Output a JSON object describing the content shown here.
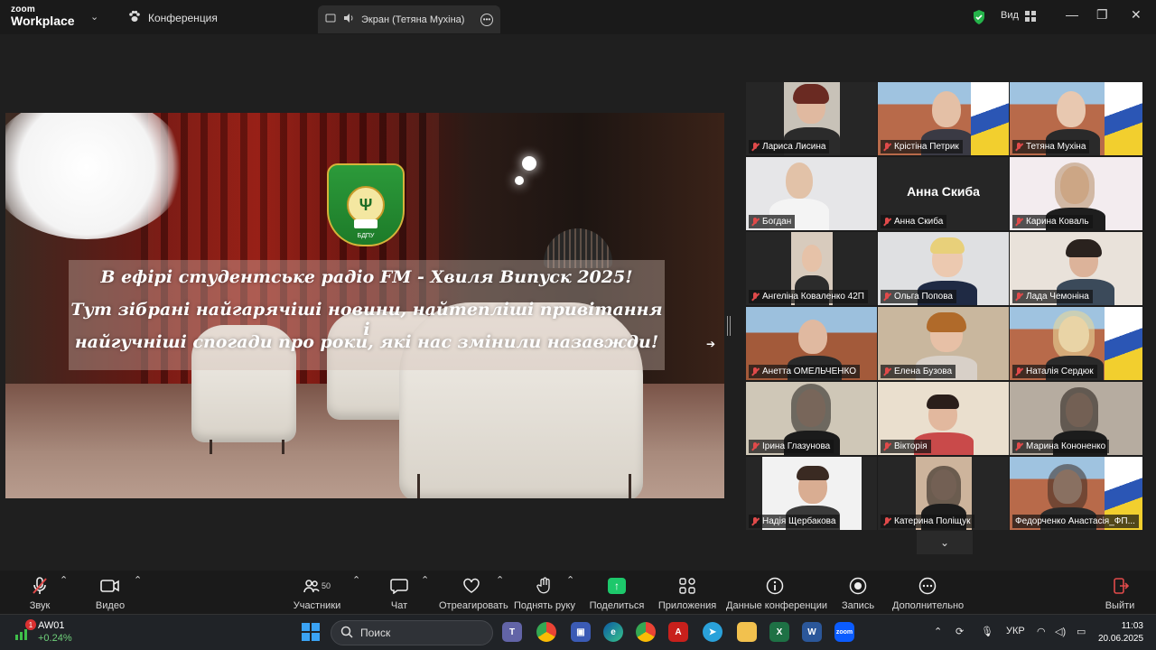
{
  "titlebar": {
    "brand_small": "zoom",
    "brand_name": "Workplace",
    "meeting_label": "Конференция",
    "screen_tab": "Экран (Тетяна Мухіна)",
    "view_label": "Вид"
  },
  "share": {
    "crest_text": "БДПУ",
    "crest_symbol": "Ψ",
    "line1": "В ефірі студентське радіо FM - Хвиля Випуск 2025!",
    "line2": "Тут зібрані найгарячіші новини, найтепліші привітання і",
    "line3": "найгучніші спогади про роки, які нас змінили назавжди!"
  },
  "gallery": {
    "participants": [
      {
        "name": "Лариса Лисина"
      },
      {
        "name": "Крістіна Петрик"
      },
      {
        "name": "Тетяна Мухіна"
      },
      {
        "name": "Богдан"
      },
      {
        "name": "Анна Скиба",
        "display": "Анна Скиба"
      },
      {
        "name": "Карина Коваль"
      },
      {
        "name": "Ангеліна Коваленко 42П"
      },
      {
        "name": "Ольга Попова"
      },
      {
        "name": "Лада Чемоніна"
      },
      {
        "name": "Анетта ОМЕЛЬЧЕНКО"
      },
      {
        "name": "Елена Бузова"
      },
      {
        "name": "Наталія Сердюк"
      },
      {
        "name": "Ірина Глазунова"
      },
      {
        "name": "Вікторія"
      },
      {
        "name": "Марина Кононенко"
      },
      {
        "name": "Надія Щербакова"
      },
      {
        "name": "Катерина Поліщук"
      },
      {
        "name": "Федорченко Анастасія_ФП..."
      }
    ]
  },
  "toolbar": {
    "audio": "Звук",
    "video": "Видео",
    "participants": "Участники",
    "participants_count": "50",
    "chat": "Чат",
    "react": "Отреагировать",
    "raise_hand": "Поднять руку",
    "share": "Поделиться",
    "apps": "Приложения",
    "meeting_info": "Данные конференции",
    "record": "Запись",
    "more": "Дополнительно",
    "leave": "Выйти"
  },
  "taskbar": {
    "stock_name": "AW01",
    "stock_change": "+0.24%",
    "stock_badge": "1",
    "search_placeholder": "Поиск",
    "language": "УКР",
    "time": "11:03",
    "date": "20.06.2025"
  },
  "colors": {
    "active_speaker": "#2fcf3f",
    "muted": "#e04a4a",
    "share_button": "#1dc86b"
  }
}
